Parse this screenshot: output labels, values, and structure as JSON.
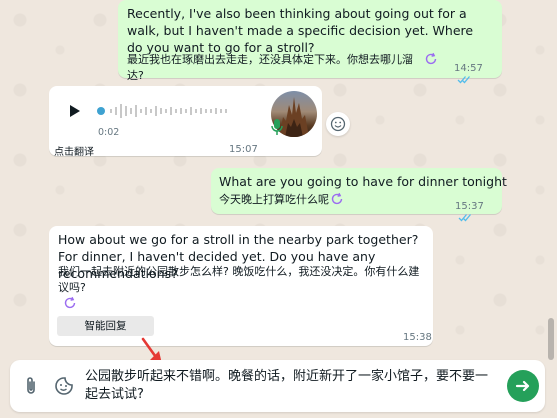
{
  "messages": {
    "m1": {
      "text": "Recently, I've also been thinking about going out for a walk, but I haven't made a specific decision yet. Where do you want to go for a stroll?",
      "translation": "最近我也在琢磨出去走走，还没具体定下来。你想去哪儿溜达?",
      "time": "14:57"
    },
    "voice": {
      "duration": "0:02",
      "translate_label": "点击翻译",
      "time": "15:07"
    },
    "m2": {
      "text": "What are you going to have for dinner tonight",
      "translation": "今天晚上打算吃什么呢",
      "time": "15:37"
    },
    "m3": {
      "text": "How about we go for a stroll in the nearby park together? For dinner, I haven't decided yet. Do you have any recommendations?",
      "translation": "我们一起去附近的公园散步怎么样? 晚饭吃什么，我还没决定。你有什么建议吗?",
      "smart_reply_label": "智能回复",
      "time": "15:38"
    }
  },
  "composer": {
    "text": "公园散步听起来不错啊。晚餐的话，附近新开了一家小馆子，要不要一起去试试?"
  },
  "colors": {
    "outgoing_bubble": "#d9fdd3",
    "incoming_bubble": "#ffffff",
    "read_ticks": "#53bdeb",
    "send_button": "#25a05a",
    "accent_icon": "#9b6cf0",
    "annotation_arrow": "#e53935"
  }
}
